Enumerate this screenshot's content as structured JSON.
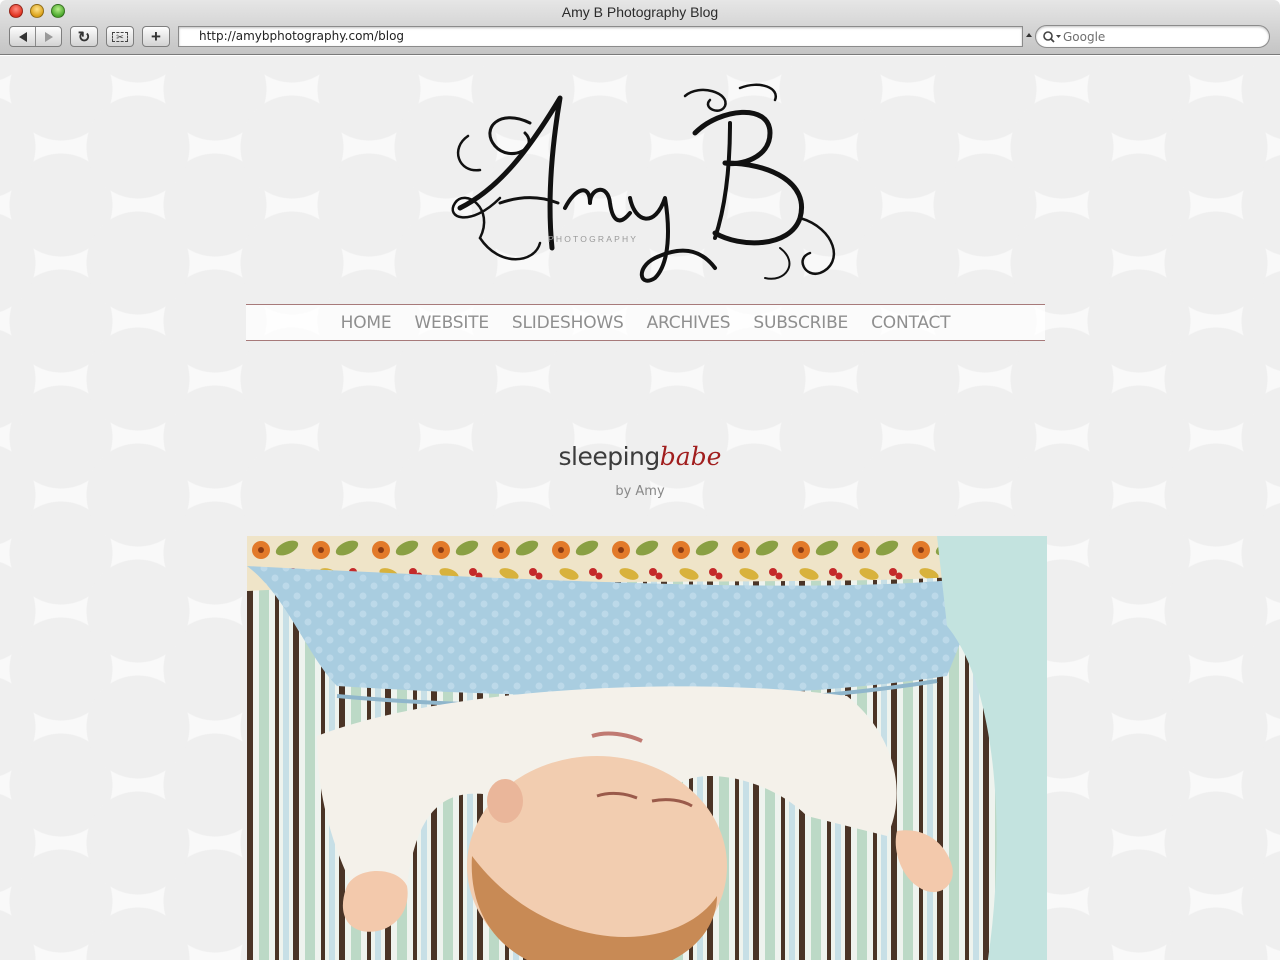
{
  "window": {
    "title": "Amy B Photography Blog"
  },
  "toolbar": {
    "url": "http://amybphotography.com/blog",
    "search_placeholder": "Google"
  },
  "logo": {
    "text": "Amy B",
    "subtext": "PHOTOGRAPHY"
  },
  "nav": {
    "items": [
      "HOME",
      "WEBSITE",
      "SLIDESHOWS",
      "ARCHIVES",
      "SUBSCRIBE",
      "CONTACT"
    ]
  },
  "post": {
    "title_main": "sleeping",
    "title_accent": "babe",
    "byline": "by Amy"
  },
  "colors": {
    "accent_red": "#a11e1e",
    "nav_text": "#8f8f8f",
    "divider": "#a77a7a",
    "polka_dot": "#efefef"
  },
  "icons": {
    "back": "back-arrow-icon",
    "forward": "forward-arrow-icon",
    "reload": "reload-icon",
    "snippet": "webclip-icon",
    "add": "add-bookmark-icon",
    "search": "search-icon"
  }
}
